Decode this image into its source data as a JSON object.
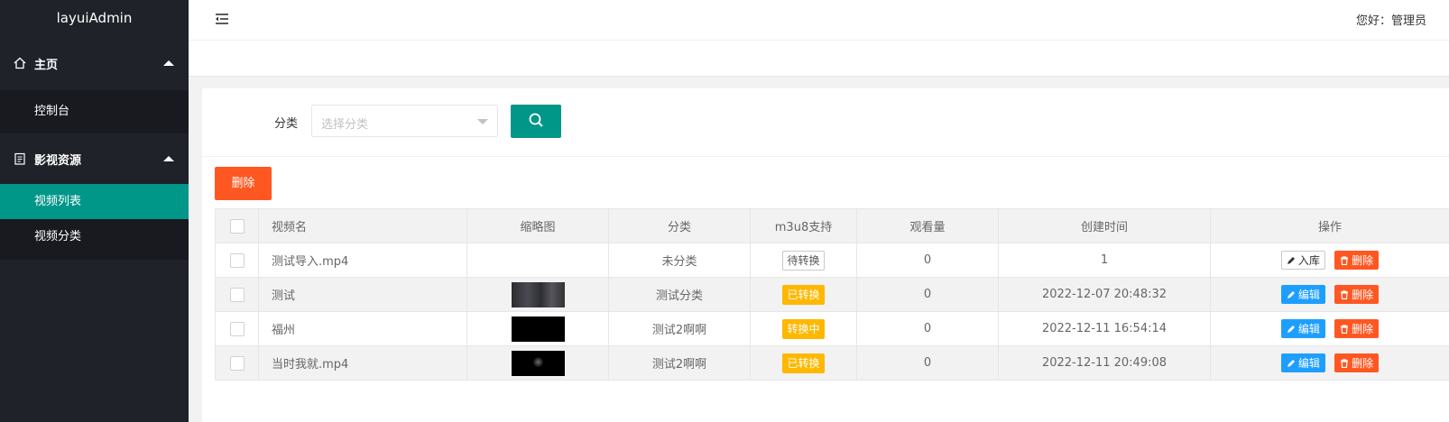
{
  "app": {
    "logo": "layuiAdmin"
  },
  "colors": {
    "sidebar_bg": "#20222a",
    "active": "#009688",
    "danger": "#ff5722",
    "warn": "#ffb800",
    "edit": "#1e9fff"
  },
  "sidebar": {
    "groups": [
      {
        "label": "主页",
        "icon": "home-icon",
        "items": [
          {
            "label": "控制台"
          }
        ]
      },
      {
        "label": "影视资源",
        "icon": "clipboard-icon",
        "items": [
          {
            "label": "视频列表",
            "active": true
          },
          {
            "label": "视频分类"
          }
        ]
      }
    ]
  },
  "header": {
    "greeting": "您好：管理员"
  },
  "filter": {
    "label": "分类",
    "placeholder": "选择分类"
  },
  "toolbar": {
    "delete_label": "删除"
  },
  "table": {
    "columns": [
      "视频名",
      "缩略图",
      "分类",
      "m3u8支持",
      "观看量",
      "创建时间",
      "操作"
    ],
    "rows": [
      {
        "name": "测试导入.mp4",
        "thumb": "",
        "category": "未分类",
        "status": "待转换",
        "status_type": "pending",
        "views": "0",
        "created": "1",
        "primary_action": "入库",
        "delete_action": "删除"
      },
      {
        "name": "测试",
        "thumb": "dark-gray",
        "category": "测试分类",
        "status": "已转换",
        "status_type": "done",
        "views": "0",
        "created": "2022-12-07 20:48:32",
        "primary_action": "编辑",
        "delete_action": "删除"
      },
      {
        "name": "福州",
        "thumb": "black",
        "category": "测试2啊啊",
        "status": "转换中",
        "status_type": "processing",
        "views": "0",
        "created": "2022-12-11 16:54:14",
        "primary_action": "编辑",
        "delete_action": "删除"
      },
      {
        "name": "当时我就.mp4",
        "thumb": "black-logo",
        "category": "测试2啊啊",
        "status": "已转换",
        "status_type": "done",
        "views": "0",
        "created": "2022-12-11 20:49:08",
        "primary_action": "编辑",
        "delete_action": "删除"
      }
    ]
  }
}
